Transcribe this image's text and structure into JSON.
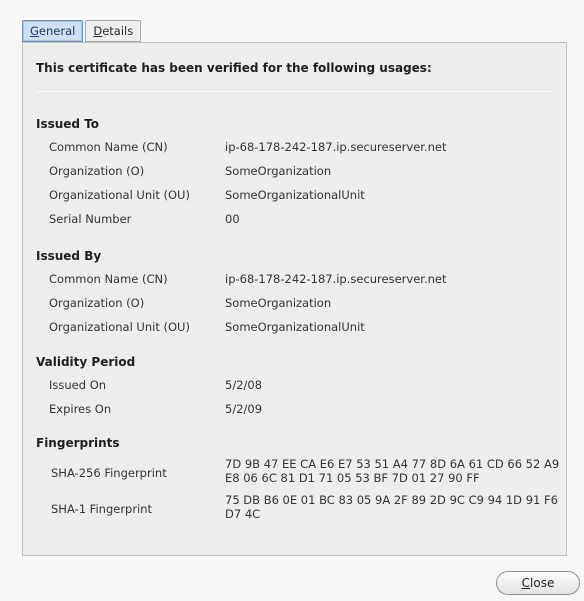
{
  "tabs": [
    {
      "accel": "G",
      "rest": "eneral",
      "active": true
    },
    {
      "accel": "D",
      "rest": "etails",
      "active": false
    }
  ],
  "verified_text": "This certificate has been verified for the following usages:",
  "issued_to": {
    "title": "Issued To",
    "rows": [
      {
        "label": "Common Name (CN)",
        "value": "ip-68-178-242-187.ip.secureserver.net"
      },
      {
        "label": "Organization (O)",
        "value": "SomeOrganization"
      },
      {
        "label": "Organizational Unit (OU)",
        "value": "SomeOrganizationalUnit"
      },
      {
        "label": "Serial Number",
        "value": "00"
      }
    ]
  },
  "issued_by": {
    "title": "Issued By",
    "rows": [
      {
        "label": "Common Name (CN)",
        "value": "ip-68-178-242-187.ip.secureserver.net"
      },
      {
        "label": "Organization (O)",
        "value": "SomeOrganization"
      },
      {
        "label": "Organizational Unit (OU)",
        "value": "SomeOrganizationalUnit"
      }
    ]
  },
  "validity": {
    "title": "Validity Period",
    "rows": [
      {
        "label": "Issued On",
        "value": "5/2/08"
      },
      {
        "label": "Expires On",
        "value": "5/2/09"
      }
    ]
  },
  "fingerprints": {
    "title": "Fingerprints",
    "rows": [
      {
        "label": "SHA-256 Fingerprint",
        "value": "7D 9B 47 EE CA E6 E7 53 51 A4 77 8D 6A 61 CD 66 52 A9 E8 06 6C 81 D1 71 05 53 BF 7D 01 27 90 FF"
      },
      {
        "label": "SHA-1 Fingerprint",
        "value": "75 DB B6 0E 01 BC 83 05 9A 2F 89 2D 9C C9 94 1D 91 F6 D7 4C"
      }
    ]
  },
  "close_button": {
    "accel": "C",
    "rest": "lose"
  }
}
